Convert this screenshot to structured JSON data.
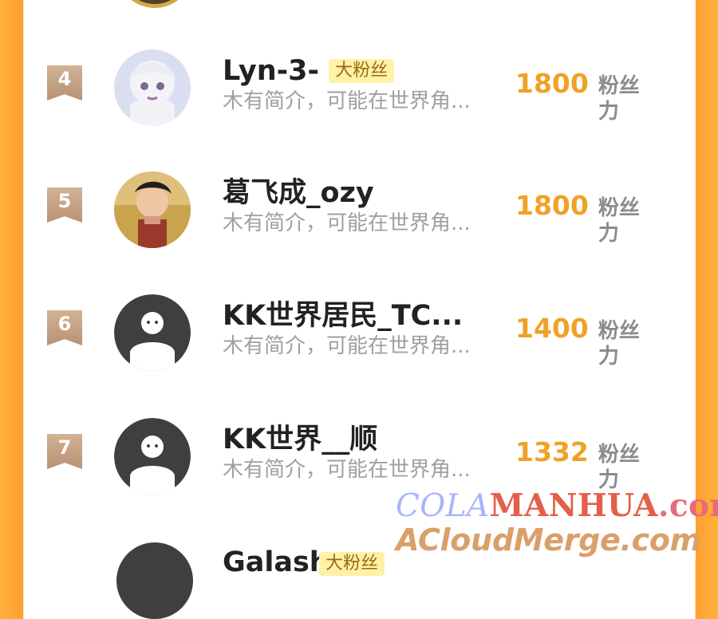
{
  "rows": [
    {
      "rank": "4",
      "name": "Lyn-3-",
      "badge": "大粉丝",
      "bio": "木有简介，可能在世界角...",
      "score": "1800",
      "unit": "粉丝力",
      "avatar": "anime-avatar"
    },
    {
      "rank": "5",
      "name": "葛飞成_ozy",
      "badge": "",
      "bio": "木有简介，可能在世界角...",
      "score": "1800",
      "unit": "粉丝力",
      "avatar": "photo-avatar"
    },
    {
      "rank": "6",
      "name": "KK世界居民_TC...",
      "badge": "",
      "bio": "木有简介，可能在世界角...",
      "score": "1400",
      "unit": "粉丝力",
      "avatar": "default-avatar"
    },
    {
      "rank": "7",
      "name": "KK世界__顺",
      "badge": "",
      "bio": "木有简介，可能在世界角...",
      "score": "1332",
      "unit": "粉丝力",
      "avatar": "default-avatar"
    }
  ],
  "partial_row": {
    "name": "Galash",
    "badge": "大粉丝"
  },
  "watermark": {
    "line1_part1": "COLA",
    "line1_part2": "MANHUA",
    "line1_part3": ".com",
    "line2": "ACloudMerge.com"
  },
  "colors": {
    "accent": "#f0a126",
    "border": "#ff9f2f",
    "badge_bg": "#fff1a6",
    "badge_text": "#9b6b12",
    "rank_badge": "#c6a384"
  },
  "icons": {
    "rank_badge": "ribbon-bookmark-icon",
    "default_avatar": "person-silhouette-icon"
  }
}
